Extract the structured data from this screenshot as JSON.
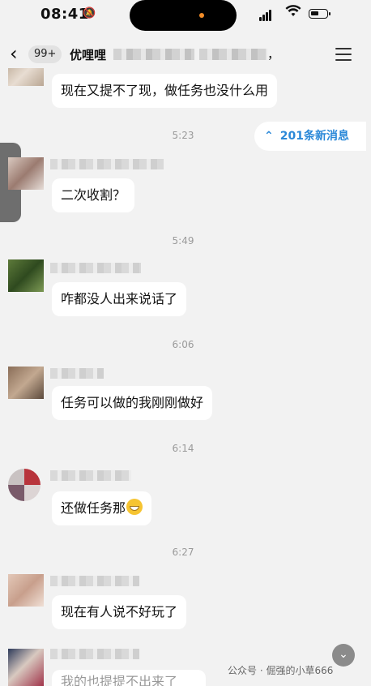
{
  "status_bar": {
    "time": "08:41",
    "bell_icon": "bell-slash-icon"
  },
  "header": {
    "back_icon": "chevron-left-icon",
    "badge": "99+",
    "title": "优哩哩",
    "title_trailing": "，",
    "menu_icon": "hamburger-menu-icon"
  },
  "new_messages": {
    "icon": "double-chevron-up-icon",
    "label": "201条新消息"
  },
  "messages": [
    {
      "text": "现在又提不了现，做任务也没什么用"
    },
    {
      "time": "5:23",
      "text": "二次收割？"
    },
    {
      "time": "5:49",
      "text": "咋都没人出来说话了"
    },
    {
      "time": "6:06",
      "text": "任务可以做的我刚刚做好"
    },
    {
      "time": "6:14",
      "text": "还做任务那",
      "emoji": "grinning-face-emoji"
    },
    {
      "time": "6:27",
      "text": "现在有人说不好玩了"
    },
    {
      "text": "我的也提提不出来了"
    }
  ],
  "watermark": "公众号 · 倔强的小草666",
  "colors": {
    "accent_blue": "#2a88d8",
    "background": "#f2f2f2",
    "bubble": "#ffffff"
  }
}
